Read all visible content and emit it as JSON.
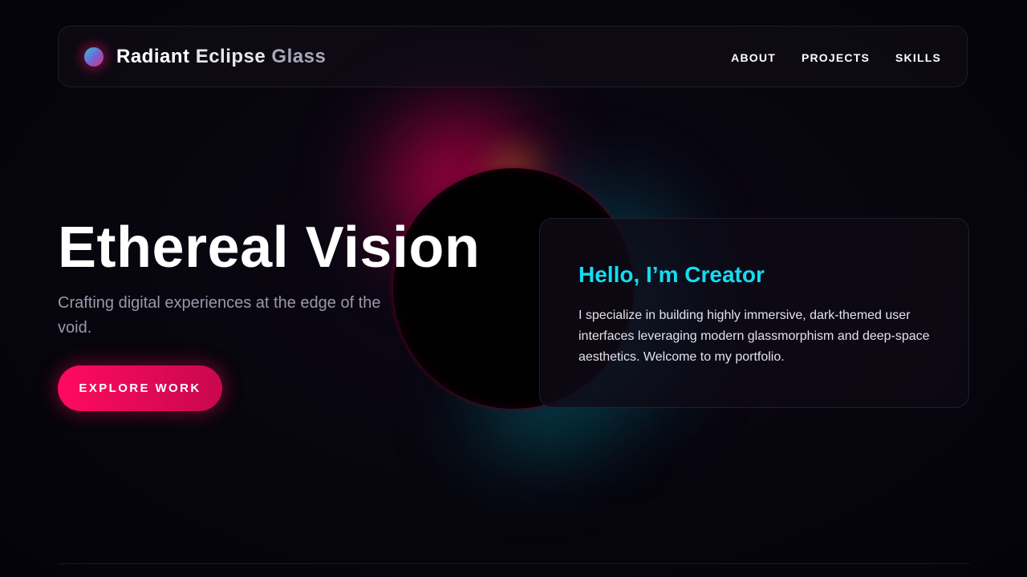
{
  "brand": {
    "part1": "Radiant",
    "part2": "Eclipse",
    "part3": "Glass",
    "logo_icon": "gradient-orb-icon"
  },
  "nav": {
    "items": [
      {
        "label": "ABOUT"
      },
      {
        "label": "PROJECTS"
      },
      {
        "label": "SKILLS"
      }
    ]
  },
  "hero": {
    "title": "Ethereal Vision",
    "subtitle": "Crafting digital experiences at the edge of the void.",
    "cta_label": "EXPLORE WORK"
  },
  "card": {
    "title": "Hello, I’m Creator",
    "text": "I specialize in building highly immersive, dark-themed user interfaces leveraging modern glassmorphism and deep-space aesthetics. Welcome to my portfolio."
  },
  "colors": {
    "background": "#06040c",
    "accent_pink": "#ff0a5e",
    "accent_cyan": "#14dcf2",
    "muted_text": "#9a98ab"
  }
}
